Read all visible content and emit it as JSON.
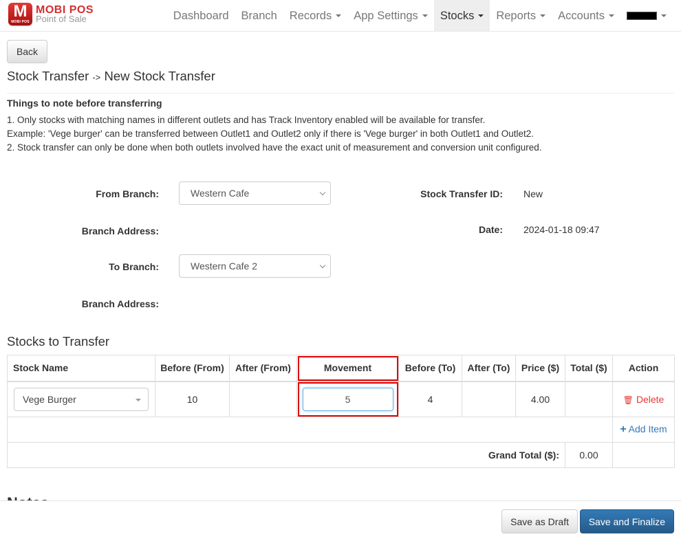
{
  "brand": {
    "logo_text": "M",
    "logo_sub": "MOBI POS",
    "title": "MOBI POS",
    "subtitle": "Point of Sale"
  },
  "nav": {
    "items": [
      {
        "label": "Dashboard",
        "dropdown": false,
        "active": false
      },
      {
        "label": "Branch",
        "dropdown": false,
        "active": false
      },
      {
        "label": "Records",
        "dropdown": true,
        "active": false
      },
      {
        "label": "App Settings",
        "dropdown": true,
        "active": false
      },
      {
        "label": "Stocks",
        "dropdown": true,
        "active": true
      },
      {
        "label": "Reports",
        "dropdown": true,
        "active": false
      },
      {
        "label": "Accounts",
        "dropdown": true,
        "active": false
      }
    ],
    "user_menu": "redacted-user"
  },
  "back_label": "Back",
  "breadcrumb": {
    "parent": "Stock Transfer",
    "separator": "->",
    "current": "New Stock Transfer"
  },
  "notes": {
    "title": "Things to note before transferring",
    "lines": [
      "1. Only stocks with matching names in different outlets and has Track Inventory enabled will be available for transfer.",
      "Example: 'Vege burger' can be transferred between Outlet1 and Outlet2 only if there is 'Vege burger' in both Outlet1 and Outlet2.",
      "2. Stock transfer can only be done when both outlets involved have the exact unit of measurement and conversion unit configured."
    ]
  },
  "form": {
    "from_branch_label": "From Branch:",
    "from_branch_value": "Western Cafe",
    "from_address_label": "Branch Address:",
    "from_address_value": "",
    "to_branch_label": "To Branch:",
    "to_branch_value": "Western Cafe 2",
    "to_address_label": "Branch Address:",
    "to_address_value": "",
    "transfer_id_label": "Stock Transfer ID:",
    "transfer_id_value": "New",
    "date_label": "Date:",
    "date_value": "2024-01-18 09:47"
  },
  "stocks": {
    "title": "Stocks to Transfer",
    "columns": [
      "Stock Name",
      "Before (From)",
      "After (From)",
      "Movement",
      "Before (To)",
      "After (To)",
      "Price ($)",
      "Total ($)",
      "Action"
    ],
    "rows": [
      {
        "stock_name": "Vege Burger",
        "before_from": "10",
        "after_from": "",
        "movement": "5",
        "before_to": "4",
        "after_to": "",
        "price": "4.00",
        "total": "",
        "action": "Delete"
      }
    ],
    "add_item_label": "Add Item",
    "grand_total_label": "Grand Total ($):",
    "grand_total_value": "0.00"
  },
  "notes_section_title": "Notes",
  "footer": {
    "draft_label": "Save as Draft",
    "finalize_label": "Save and Finalize"
  },
  "colors": {
    "brand_red": "#d32f2f",
    "primary_blue": "#337ab7",
    "delete_red": "#e53935",
    "highlight_red": "#dd0000"
  }
}
